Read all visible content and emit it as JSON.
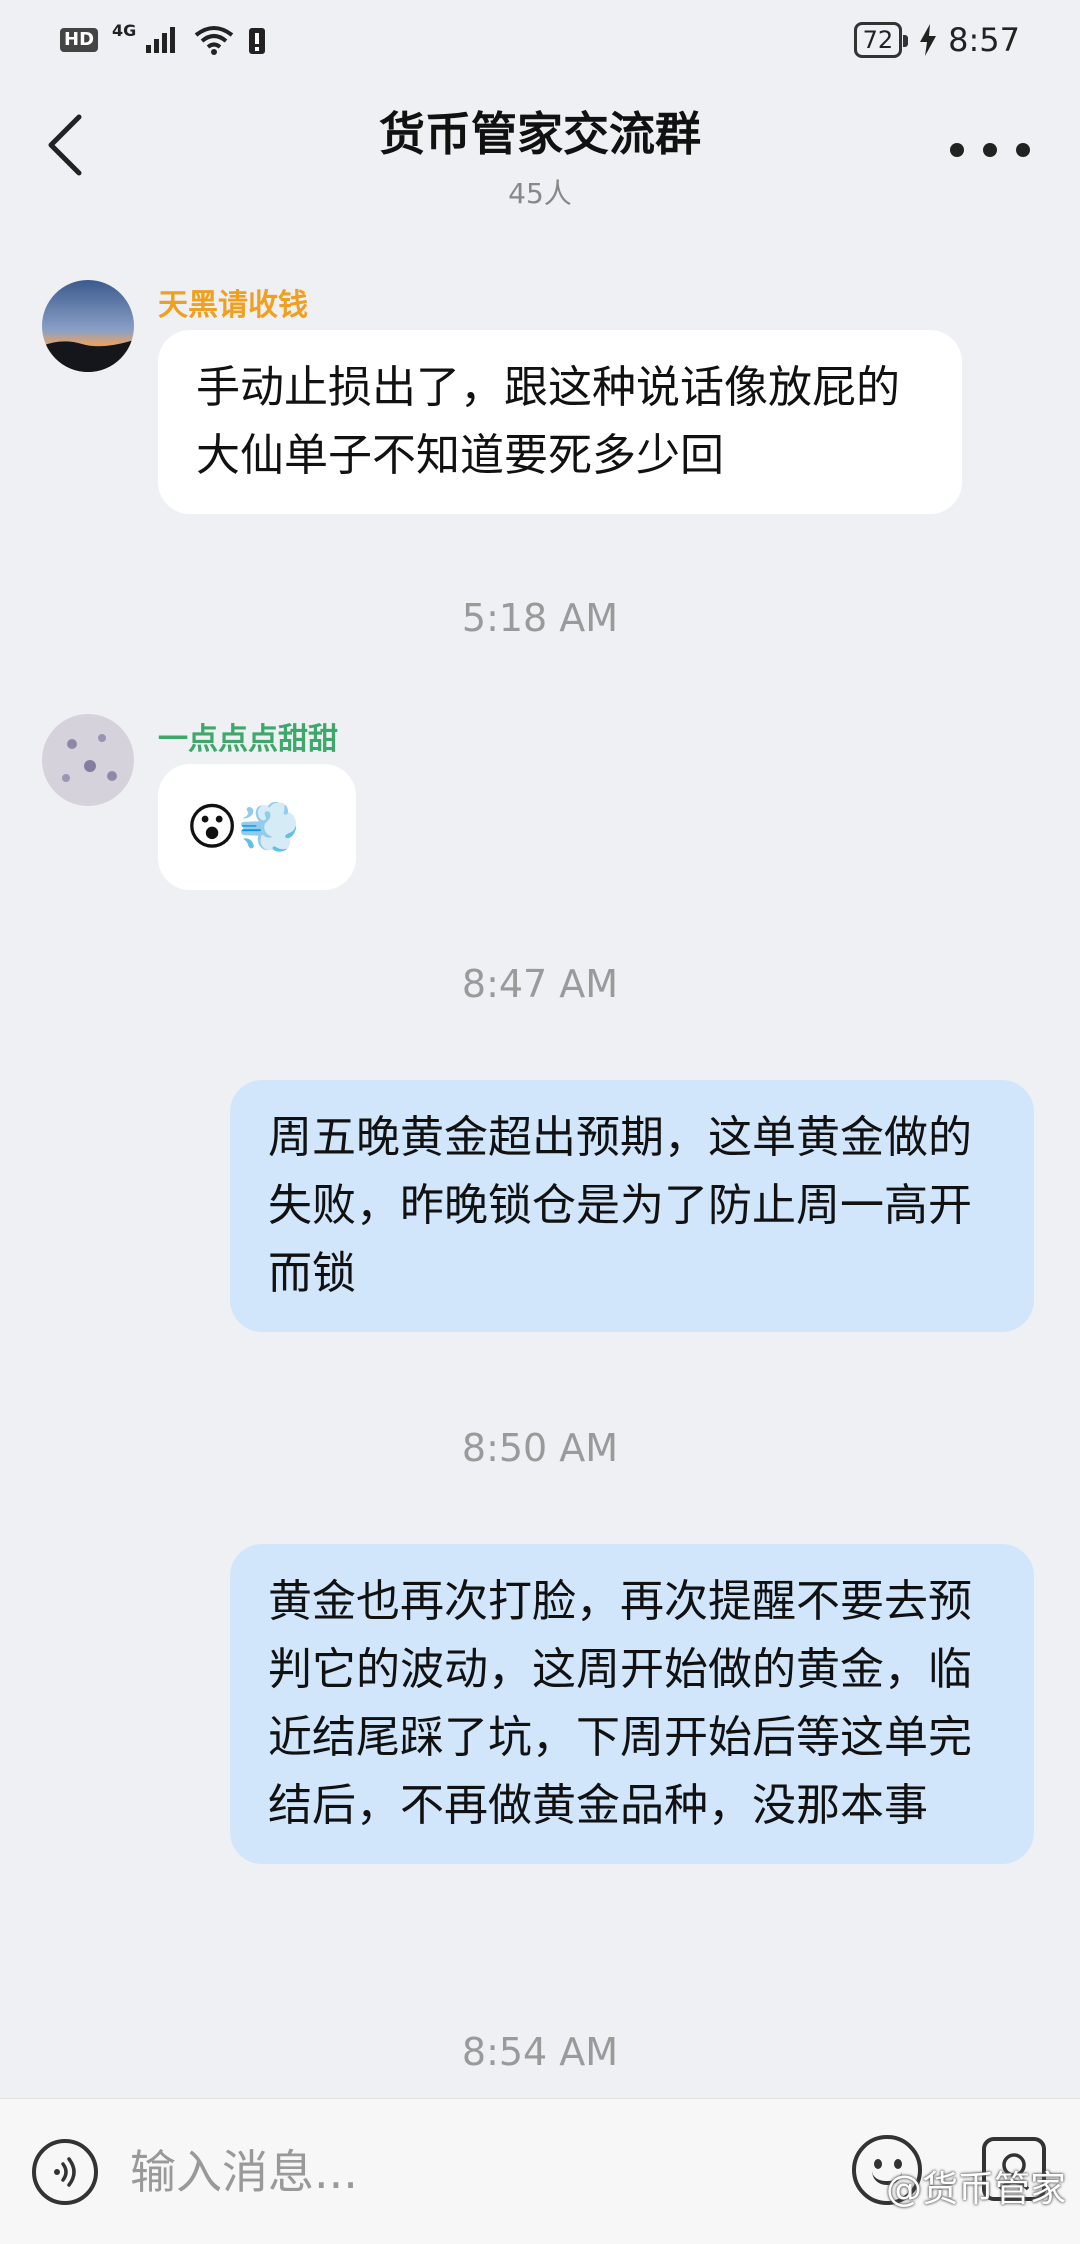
{
  "status_bar": {
    "hd": "HD",
    "network": "4G",
    "battery": "72",
    "time": "8:57"
  },
  "header": {
    "title": "货币管家交流群",
    "member_count": "45人"
  },
  "messages": [
    {
      "sender": "天黑请收钱",
      "sender_color": "#f0a020",
      "text": "手动止损出了，跟这种说话像放屁的大仙单子不知道要死多少回"
    },
    {
      "timestamp": "5:18 AM"
    },
    {
      "sender": "一点点点甜甜",
      "sender_color": "#3ea86a",
      "emoji": "😮💨"
    },
    {
      "timestamp": "8:47 AM"
    },
    {
      "text": "周五晚黄金超出预期，这单黄金做的失败，昨晚锁仓是为了防止周一高开而锁"
    },
    {
      "timestamp": "8:50 AM"
    },
    {
      "text": "黄金也再次打脸，再次提醒不要去预判它的波动，这周开始做的黄金，临近结尾踩了坑，下周开始后等这单完结后，不再做黄金品种，没那本事"
    },
    {
      "timestamp": "8:54 AM"
    }
  ],
  "input": {
    "placeholder": "输入消息..."
  },
  "watermark": "@货币管家",
  "icons": {
    "back": "back-arrow-icon",
    "more": "more-dots-icon",
    "voice": "voice-icon",
    "emoji": "emoji-icon",
    "image": "image-icon"
  }
}
